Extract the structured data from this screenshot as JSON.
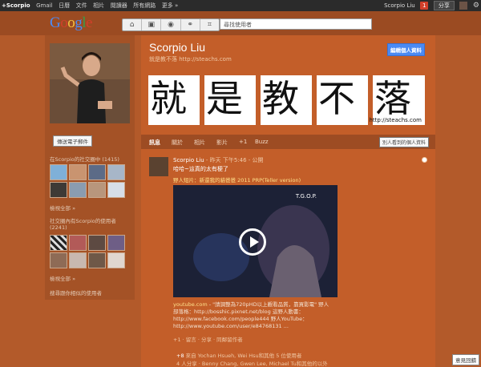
{
  "topbar": {
    "nav": [
      "+Scorpio",
      "Gmail",
      "日曆",
      "文件",
      "相片",
      "閱讀器",
      "所有網路",
      "更多 »"
    ],
    "user": "Scorpio Liu",
    "notifications": "1",
    "share": "分享"
  },
  "header": {
    "logo": "Google",
    "search_placeholder": "尋找使用者",
    "tabs": [
      "⌂",
      "▣",
      "◉",
      "⚭",
      "⌗"
    ]
  },
  "left": {
    "send_mail": "傳送電子郵件",
    "in_circles_title": "在Scorpio的社交圈中 (1415)",
    "in_circles_more": "檢視全部 »",
    "has_circles_title": "社交圈內有Scorpio的使用者 (2241)",
    "has_circles_more": "檢視全部 »",
    "similar": "搜尋跟你相似的使用者"
  },
  "profile": {
    "name": "Scorpio Liu",
    "tagline": "就是教不落 http://steachs.com",
    "edit_button": "編輯個人資料",
    "banner_chars": [
      "就",
      "是",
      "教",
      "不",
      "落"
    ],
    "banner_url": "http://steachs.com",
    "tabs": [
      "訊息",
      "關於",
      "相片",
      "影片",
      "+1",
      "Buzz"
    ],
    "view_as": "別人看到的個人資料"
  },
  "post": {
    "author": "Scorpio Liu",
    "meta": " - 昨天 下午5:46 - 公開",
    "text": "哈哈~這真的太有梗了",
    "link_title": "野人短片：新還我的貓爸爸 2011 PRP(Teller version)",
    "video_title": "T.G.O.P.",
    "desc_src": "youtube.com",
    "desc_text": " - \"請調整為720pHD以上觀看品質，靠買影電\" 野人部落格：http://bosshic.pixnet.net/blog 這野人動書：http://www.facebook.com/people444 野人YouTube：http://www.youtube.com/user/e84768131 ...",
    "actions": "+1  ·  留言  ·  分享  ·  同鄰留作者",
    "plus_prefix": "+8",
    "plus_line": " 來自 Yochan Hsueh, Wei Hsu和其他 5 位使用者",
    "shares_line": "4 人分享 · Benny Chang, Gwen Lee, Michael Tu和其他的以外"
  },
  "feedback": "意見回饋",
  "colors": {
    "topbar": "#2b2b2b",
    "page_bg": "#b35a2a",
    "main_bg": "#c35e29",
    "accent_blue": "#4a8af4"
  }
}
